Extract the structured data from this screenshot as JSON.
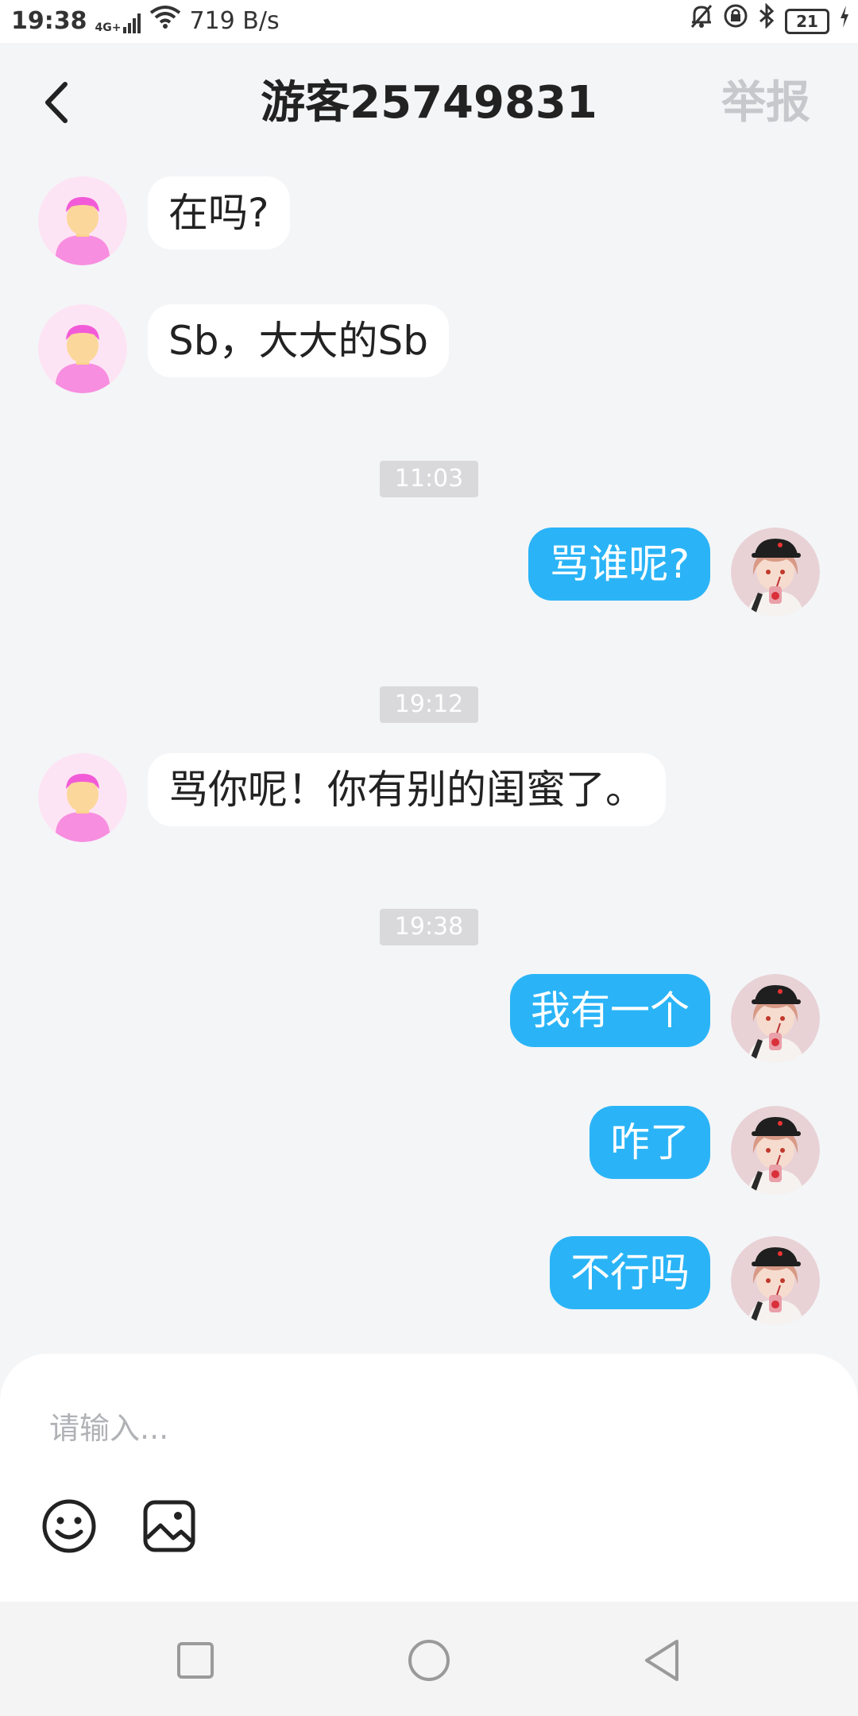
{
  "status_bar": {
    "time": "19:38",
    "network_type": "4G+",
    "speed": "719 B/s",
    "battery_level": "21",
    "icons": [
      "signal-icon",
      "wifi-icon",
      "mute-icon",
      "rotation-lock-icon",
      "bluetooth-icon",
      "battery-icon",
      "charging-icon"
    ]
  },
  "header": {
    "title": "游客25749831",
    "report_label": "举报",
    "back_icon": "chevron-left-icon"
  },
  "messages": [
    {
      "side": "left",
      "text": "在吗?"
    },
    {
      "side": "left",
      "text": "Sb，大大的Sb"
    },
    {
      "type": "timestamp",
      "text": "11:03"
    },
    {
      "side": "right",
      "text": "骂谁呢?"
    },
    {
      "type": "timestamp",
      "text": "19:12"
    },
    {
      "side": "left",
      "text": "骂你呢！你有别的闺蜜了。"
    },
    {
      "type": "timestamp",
      "text": "19:38"
    },
    {
      "side": "right",
      "text": "我有一个"
    },
    {
      "side": "right",
      "text": "咋了"
    },
    {
      "side": "right",
      "text": "不行吗"
    }
  ],
  "input": {
    "placeholder": "请输入...",
    "value": ""
  },
  "toolbar": {
    "icons": [
      "emoji-icon",
      "image-icon"
    ]
  },
  "nav": {
    "icons": [
      "recents-square-icon",
      "home-circle-icon",
      "back-triangle-icon"
    ]
  },
  "colors": {
    "background": "#f4f5f7",
    "sent_bubble": "#2ab4f7",
    "received_bubble": "#ffffff",
    "timestamp_bg": "#d9d9db",
    "report_text": "#c6c8cc"
  }
}
